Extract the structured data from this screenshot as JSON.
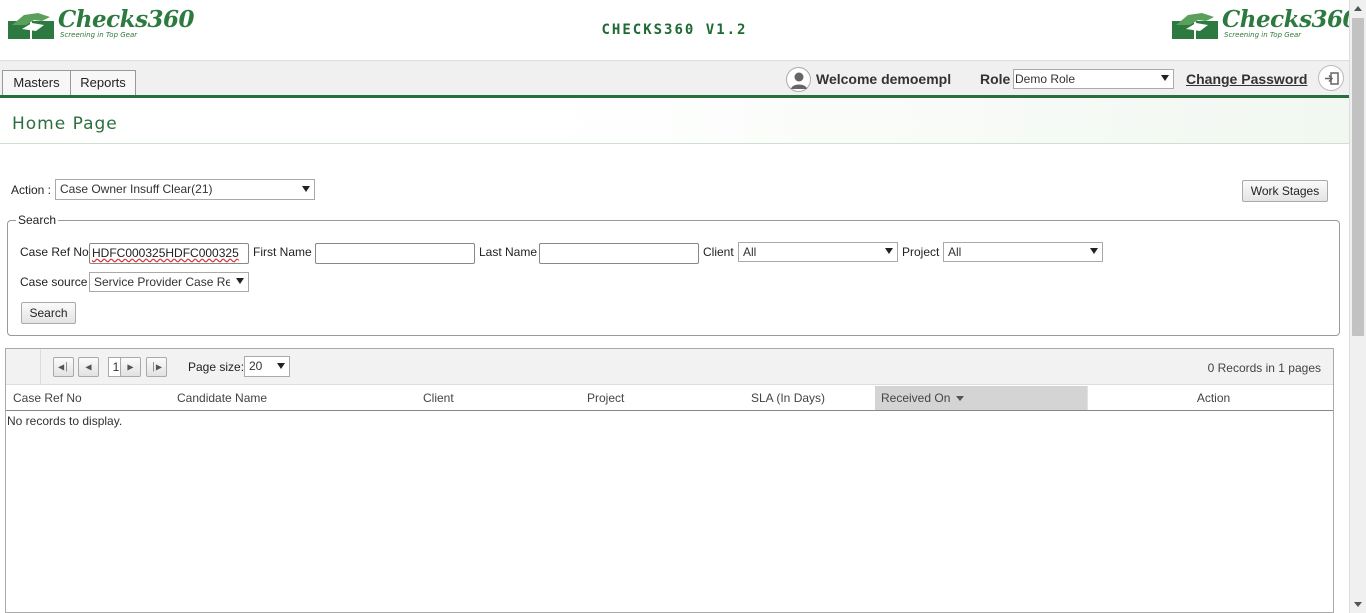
{
  "header": {
    "logo_text": "Checks360",
    "logo_tagline": "Screening in Top Gear",
    "app_title": "CHECKS360 V1.2"
  },
  "nav": {
    "tabs": [
      {
        "label": "Masters"
      },
      {
        "label": "Reports"
      }
    ],
    "welcome": "Welcome demoempl",
    "role_label": "Role",
    "role_value": "Demo Role",
    "change_password": "Change Password",
    "icons": {
      "user": "user-avatar-icon",
      "logout": "logout-icon"
    }
  },
  "page": {
    "title": "Home Page"
  },
  "action": {
    "label": "Action :",
    "selected": "Case Owner Insuff Clear(21)",
    "work_stages": "Work Stages"
  },
  "search": {
    "legend": "Search",
    "case_ref_label": "Case Ref No",
    "case_ref_value": "HDFC000325HDFC000325",
    "first_name_label": "First Name",
    "first_name_value": "",
    "last_name_label": "Last Name",
    "last_name_value": "",
    "client_label": "Client",
    "client_value": "All",
    "project_label": "Project",
    "project_value": "All",
    "case_source_label": "Case source",
    "case_source_value": "Service Provider Case Req",
    "search_button": "Search"
  },
  "grid": {
    "current_page": "1",
    "page_size_label": "Page size:",
    "page_size": "20",
    "records_summary": "0 Records in 1 pages",
    "columns": [
      {
        "label": "Case Ref No"
      },
      {
        "label": "Candidate Name"
      },
      {
        "label": "Client"
      },
      {
        "label": "Project"
      },
      {
        "label": "SLA (In Days)"
      },
      {
        "label": "Received On"
      },
      {
        "label": "Action"
      }
    ],
    "sorted_column": "Received On",
    "empty_message": "No records to display.",
    "rows": []
  },
  "colors": {
    "brand_green": "#2c7a3f",
    "nav_line": "#2a6e3c",
    "title_green": "#2c6e3e"
  }
}
